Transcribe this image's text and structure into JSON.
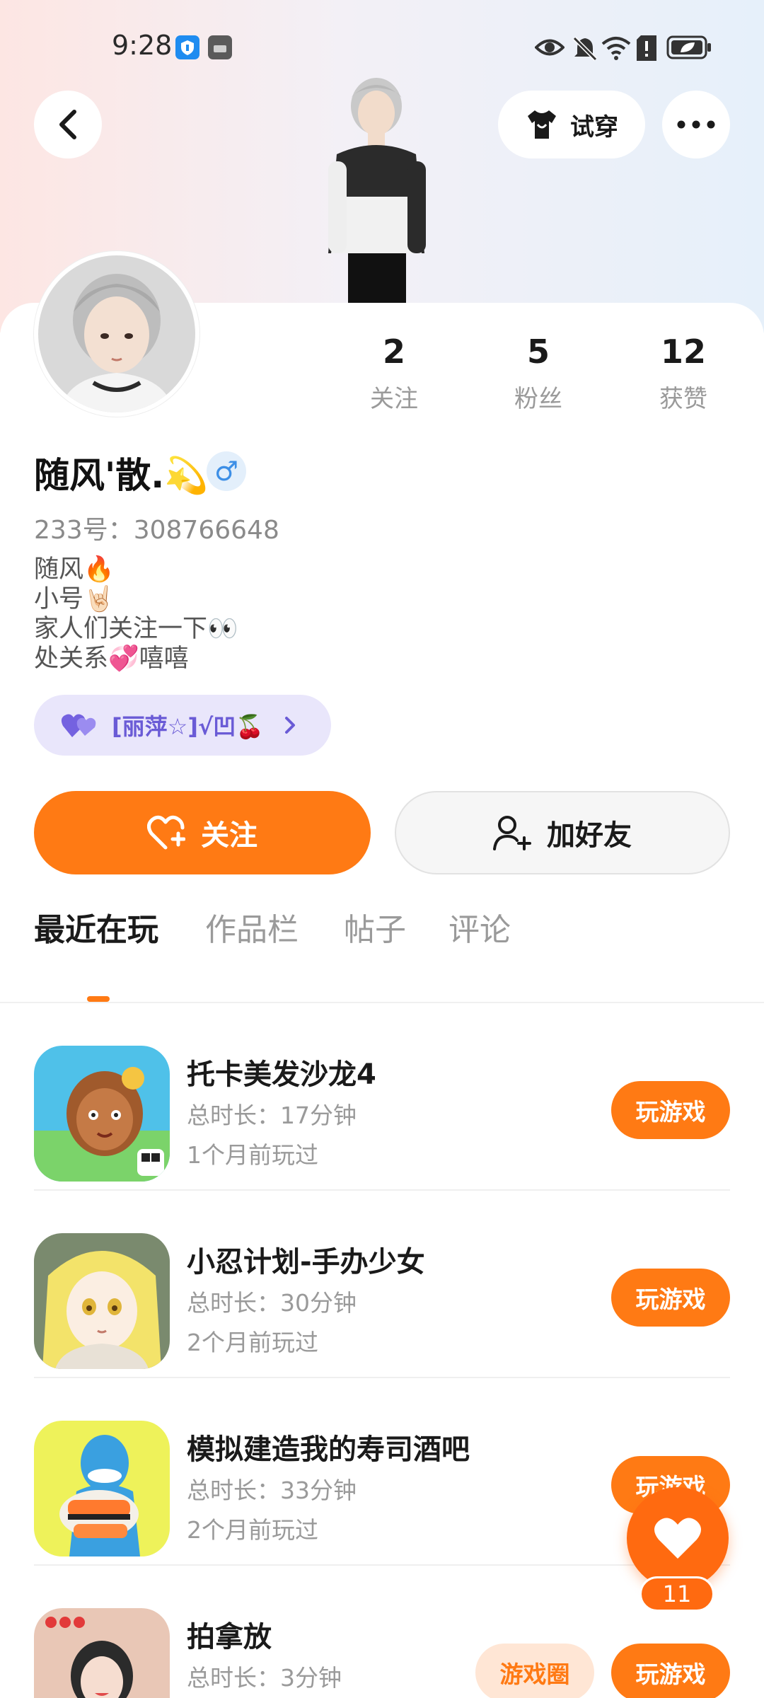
{
  "status_bar": {
    "time": "9:28",
    "icons": [
      "shield-app-icon",
      "huawei-app-icon",
      "eye-icon",
      "mute-bell-icon",
      "wifi-icon",
      "alert-sim-icon",
      "battery-icon"
    ]
  },
  "header": {
    "back_icon": "chevron-left-icon",
    "try_on_label": "试穿",
    "try_on_icon": "tshirt-icon",
    "more_icon": "more-dots-icon"
  },
  "profile": {
    "username": "随风'散.💫",
    "gender_symbol": "♂",
    "uid": "233号：308766648",
    "bio": [
      "随风🔥",
      "小号🤘🏻",
      "家人们关注一下👀",
      "处关系💞嘻嘻"
    ],
    "cp_tag": "[丽萍☆]√凹🍒",
    "stats": [
      {
        "value": "2",
        "label": "关注"
      },
      {
        "value": "5",
        "label": "粉丝"
      },
      {
        "value": "12",
        "label": "获赞"
      }
    ]
  },
  "actions": {
    "follow_label": "关注",
    "add_friend_label": "加好友"
  },
  "tabs": [
    {
      "label": "最近在玩",
      "active": true
    },
    {
      "label": "作品栏",
      "active": false
    },
    {
      "label": "帖子",
      "active": false
    },
    {
      "label": "评论",
      "active": false
    }
  ],
  "games": [
    {
      "name": "托卡美发沙龙4",
      "duration": "总时长：17分钟",
      "last_played": "1个月前玩过",
      "play_label": "玩游戏"
    },
    {
      "name": "小忍计划-手办少女",
      "duration": "总时长：30分钟",
      "last_played": "2个月前玩过",
      "play_label": "玩游戏"
    },
    {
      "name": "模拟建造我的寿司酒吧",
      "duration": "总时长：33分钟",
      "last_played": "2个月前玩过",
      "play_label": "玩游戏"
    },
    {
      "name": "拍拿放",
      "duration": "总时长：3分钟",
      "last_played": "",
      "play_label": "玩游戏",
      "circle_label": "游戏圈"
    }
  ],
  "like_fab": {
    "count": "11"
  },
  "colors": {
    "accent": "#ff7a14",
    "cp_tag_bg": "#e9e6fb",
    "cp_tag_text": "#6a5bd6"
  }
}
